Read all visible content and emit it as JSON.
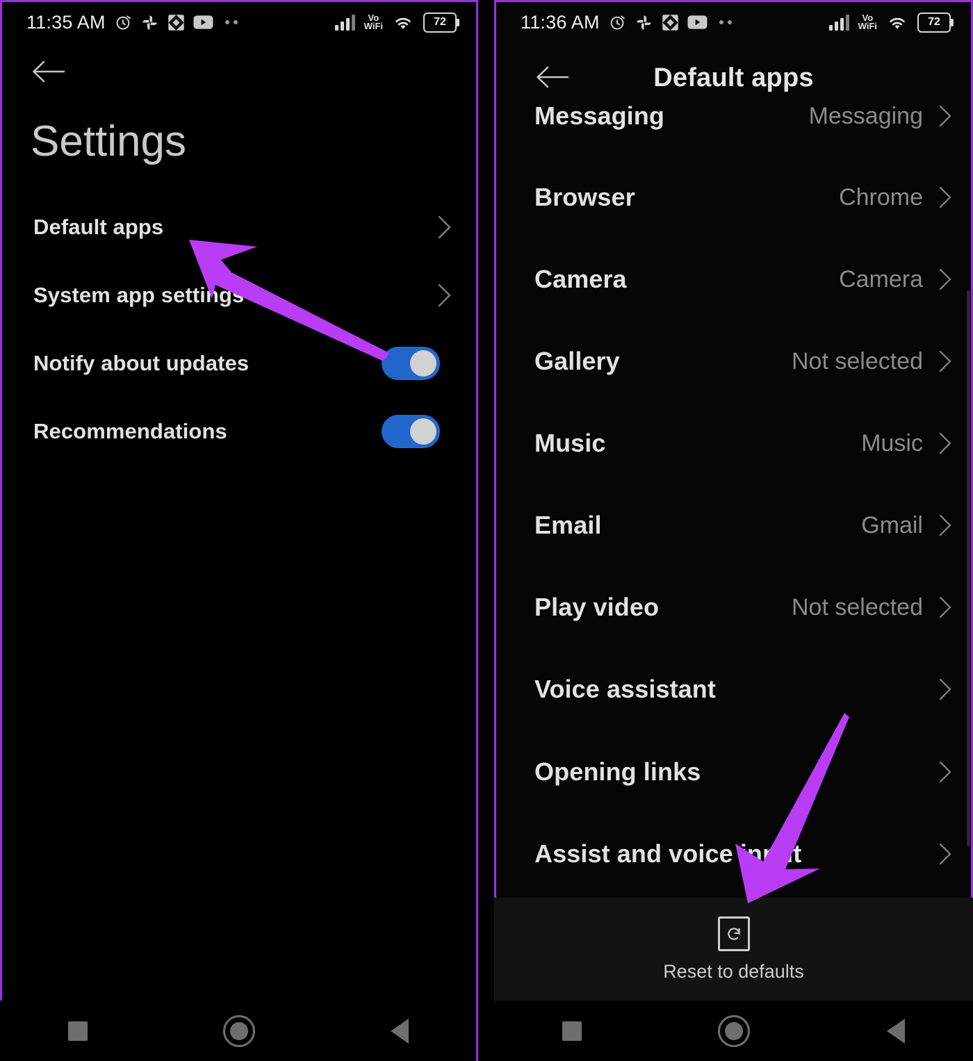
{
  "annotation": {
    "arrow_color": "#b83df5",
    "frame_color": "#9b30e0"
  },
  "left_screen": {
    "status_bar": {
      "time": "11:35 AM",
      "notification_icons": [
        "alarm-clock-icon",
        "google-photos-icon",
        "app-diamond-icon",
        "youtube-icon",
        "more-notifications-dots-icon"
      ],
      "signal_icon": "cellular-signal-icon",
      "network_label_top": "Vo",
      "network_label_bottom": "WiFi",
      "wifi_icon": "wifi-icon",
      "battery_percent": "72"
    },
    "back_label": "Back",
    "page_title": "Settings",
    "rows": [
      {
        "label": "Default apps",
        "type": "chevron"
      },
      {
        "label": "System app settings",
        "type": "chevron"
      },
      {
        "label": "Notify about updates",
        "type": "toggle",
        "toggle_on": true
      },
      {
        "label": "Recommendations",
        "type": "toggle",
        "toggle_on": true
      }
    ],
    "nav_bar": {
      "recents": "recents-icon",
      "home": "home-icon",
      "back": "back-icon"
    }
  },
  "right_screen": {
    "status_bar": {
      "time": "11:36 AM",
      "notification_icons": [
        "alarm-clock-icon",
        "google-photos-icon",
        "app-diamond-icon",
        "youtube-icon",
        "more-notifications-dots-icon"
      ],
      "signal_icon": "cellular-signal-icon",
      "network_label_top": "Vo",
      "network_label_bottom": "WiFi",
      "wifi_icon": "wifi-icon",
      "battery_percent": "72"
    },
    "app_bar": {
      "title": "Default apps",
      "back_label": "Back"
    },
    "rows": [
      {
        "label": "Messaging",
        "value": "Messaging",
        "clipped": true
      },
      {
        "label": "Browser",
        "value": "Chrome"
      },
      {
        "label": "Camera",
        "value": "Camera"
      },
      {
        "label": "Gallery",
        "value": "Not selected"
      },
      {
        "label": "Music",
        "value": "Music"
      },
      {
        "label": "Email",
        "value": "Gmail"
      },
      {
        "label": "Play video",
        "value": "Not selected"
      },
      {
        "label": "Voice assistant",
        "value": ""
      },
      {
        "label": "Opening links",
        "value": ""
      },
      {
        "label": "Assist and voice input",
        "value": ""
      }
    ],
    "action_bar": {
      "icon": "reset-icon",
      "label": "Reset to defaults"
    },
    "nav_bar": {
      "recents": "recents-icon",
      "home": "home-icon",
      "back": "back-icon"
    }
  }
}
